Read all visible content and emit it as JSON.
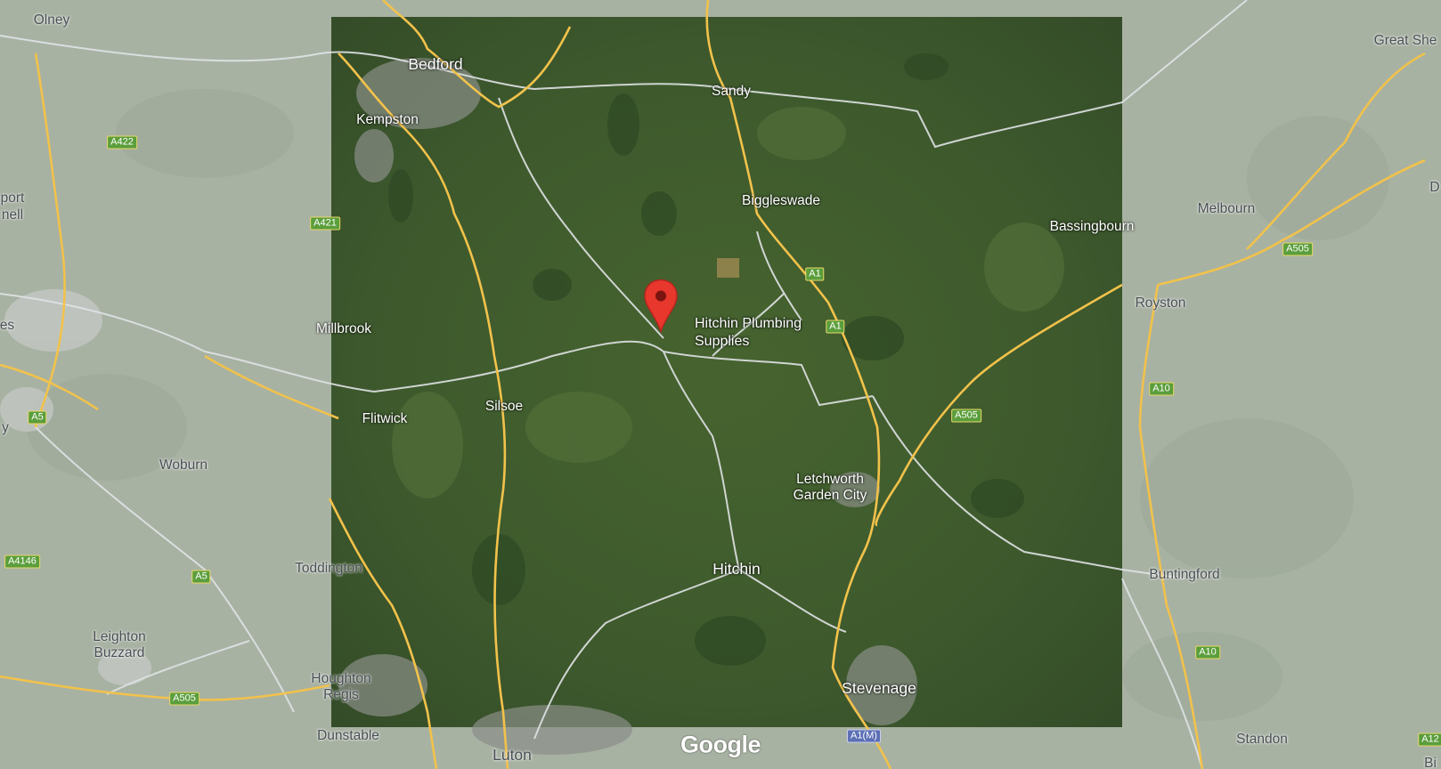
{
  "map": {
    "places": [
      {
        "id": "olney",
        "label": "Olney"
      },
      {
        "id": "bedford",
        "label": "Bedford"
      },
      {
        "id": "kempston",
        "label": "Kempston"
      },
      {
        "id": "sandy",
        "label": "Sandy"
      },
      {
        "id": "great-shelford",
        "label": "Great She"
      },
      {
        "id": "port-nell-1",
        "label": "port"
      },
      {
        "id": "port-nell-2",
        "label": "nell"
      },
      {
        "id": "biggleswade",
        "label": "Biggleswade"
      },
      {
        "id": "bassingbourn",
        "label": "Bassingbourn"
      },
      {
        "id": "melbourn",
        "label": "Melbourn"
      },
      {
        "id": "royston",
        "label": "Royston"
      },
      {
        "id": "millbrook",
        "label": "Millbrook"
      },
      {
        "id": "es",
        "label": "es"
      },
      {
        "id": "flitwick",
        "label": "Flitwick"
      },
      {
        "id": "silsoe",
        "label": "Silsoe"
      },
      {
        "id": "woburn",
        "label": "Woburn"
      },
      {
        "id": "letchworth",
        "label": "Letchworth\nGarden City"
      },
      {
        "id": "toddington",
        "label": "Toddington"
      },
      {
        "id": "hitchin",
        "label": "Hitchin"
      },
      {
        "id": "buntingford",
        "label": "Buntingford"
      },
      {
        "id": "leighton-buzzard",
        "label": "Leighton\nBuzzard"
      },
      {
        "id": "houghton-regis",
        "label": "Houghton\nRegis"
      },
      {
        "id": "stevenage",
        "label": "Stevenage"
      },
      {
        "id": "dunstable",
        "label": "Dunstable"
      },
      {
        "id": "luton",
        "label": "Luton"
      },
      {
        "id": "standon",
        "label": "Standon"
      },
      {
        "id": "edge-d",
        "label": "D"
      },
      {
        "id": "edge-y",
        "label": "y"
      },
      {
        "id": "edge-bi",
        "label": "Bi"
      }
    ],
    "roads": [
      {
        "id": "a422",
        "label": "A422"
      },
      {
        "id": "a421",
        "label": "A421"
      },
      {
        "id": "a1-north",
        "label": "A1"
      },
      {
        "id": "a1-mid",
        "label": "A1"
      },
      {
        "id": "a505-east",
        "label": "A505"
      },
      {
        "id": "a505-road",
        "label": "A505"
      },
      {
        "id": "a10-north",
        "label": "A10"
      },
      {
        "id": "a10-south",
        "label": "A10"
      },
      {
        "id": "a5-north",
        "label": "A5"
      },
      {
        "id": "a5-south",
        "label": "A5"
      },
      {
        "id": "a4146",
        "label": "A4146"
      },
      {
        "id": "a505-west",
        "label": "A505"
      },
      {
        "id": "a1m",
        "label": "A1(M)"
      },
      {
        "id": "a12-edge",
        "label": "A12"
      }
    ],
    "marker": {
      "label_line1": "Hitchin Plumbing",
      "label_line2": "Supplies",
      "color": "#e8372c"
    },
    "logo": "Google",
    "colors": {
      "satellite": "#3d5a30",
      "basemap": "#a9b3a4",
      "major_road": "#f2c24b",
      "minor_road": "#e4e6e8"
    }
  }
}
